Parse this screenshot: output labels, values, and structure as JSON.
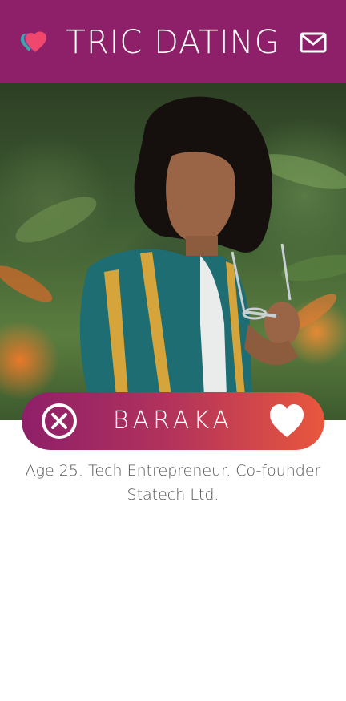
{
  "header": {
    "title": "TRIC DATING",
    "logo_icon": "heart-logo-icon",
    "mail_icon": "mail-icon",
    "background": "#8e1f69"
  },
  "profile": {
    "name": "BARAKA",
    "bio": "Age 25. Tech Entrepreneur. Co-founder Statech Ltd.",
    "photo_description_icon": "profile-photo"
  },
  "actions": {
    "reject_icon": "close-circle-icon",
    "like_icon": "heart-icon",
    "gradient_start": "#8e1f69",
    "gradient_end": "#e9573d"
  }
}
